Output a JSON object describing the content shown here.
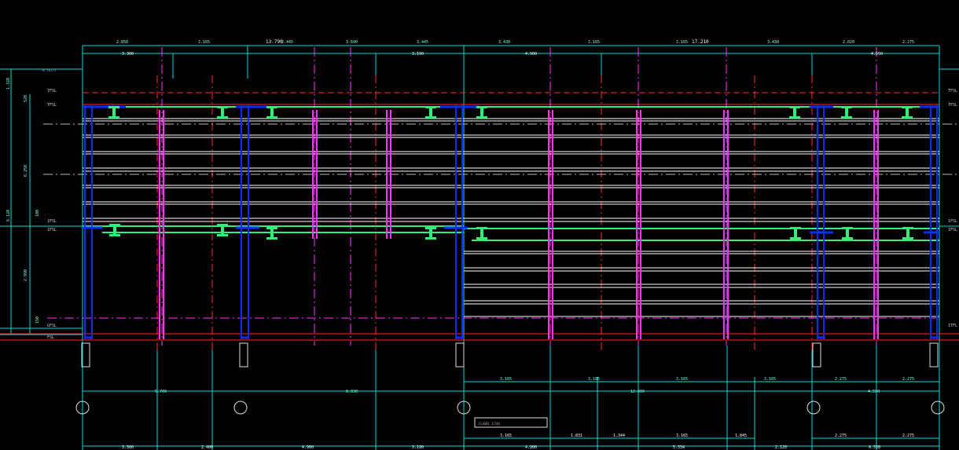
{
  "drawing": {
    "title_label": "13.790",
    "title_label_right": "17.210",
    "scale_note": "(S1003 1/50)",
    "left_tag": "TW-TW1+5",
    "colors": {
      "grid": "#00e0e0",
      "beam_green": "#33ee77",
      "column_blue": "#0a2cff",
      "column_magenta": "#ff33ff",
      "level_red": "#ff2a2a",
      "white": "#ffffff",
      "background": "#000000"
    }
  },
  "top_dims_row1": [
    "2.850",
    "3.165",
    "13.790",
    "2.445",
    "3.690",
    "3.445",
    "3.430",
    "3.165",
    "3.165",
    "17.210",
    "3.430",
    "2.020",
    "2.275"
  ],
  "top_dims_row2": [
    "3.300",
    "3.190",
    "4.900",
    "4.550"
  ],
  "level_labels_left": [
    "TFSL",
    "TFSL",
    "1FSL",
    "1FSL",
    "GFSL",
    "FSL"
  ],
  "level_labels_right": [
    "TFSL",
    "TFSL",
    "1FSL",
    "1FSL",
    "1TFL"
  ],
  "left_vertical_dims": [
    "1.320",
    "520",
    "6.250",
    "6.120",
    "100",
    "2.990",
    "150"
  ],
  "bottom_dims_row1": [
    "3.165",
    "3.165",
    "3.165",
    "3.165",
    "2.275",
    "2.275"
  ],
  "bottom_dims_row2": [
    "5.700",
    "8.030",
    "12.000",
    "4.550"
  ],
  "bottom_dims_row3": [
    "3.165",
    "1.831",
    "1.344",
    "3.165",
    "1.845"
  ],
  "bottom_dims_row4": [
    "3.300",
    "2.400",
    "4.900",
    "3.190",
    "4.900",
    "5.334",
    "2.120",
    "4.550"
  ],
  "bottom_dims_row3b": [
    "2.275",
    "2.275"
  ]
}
